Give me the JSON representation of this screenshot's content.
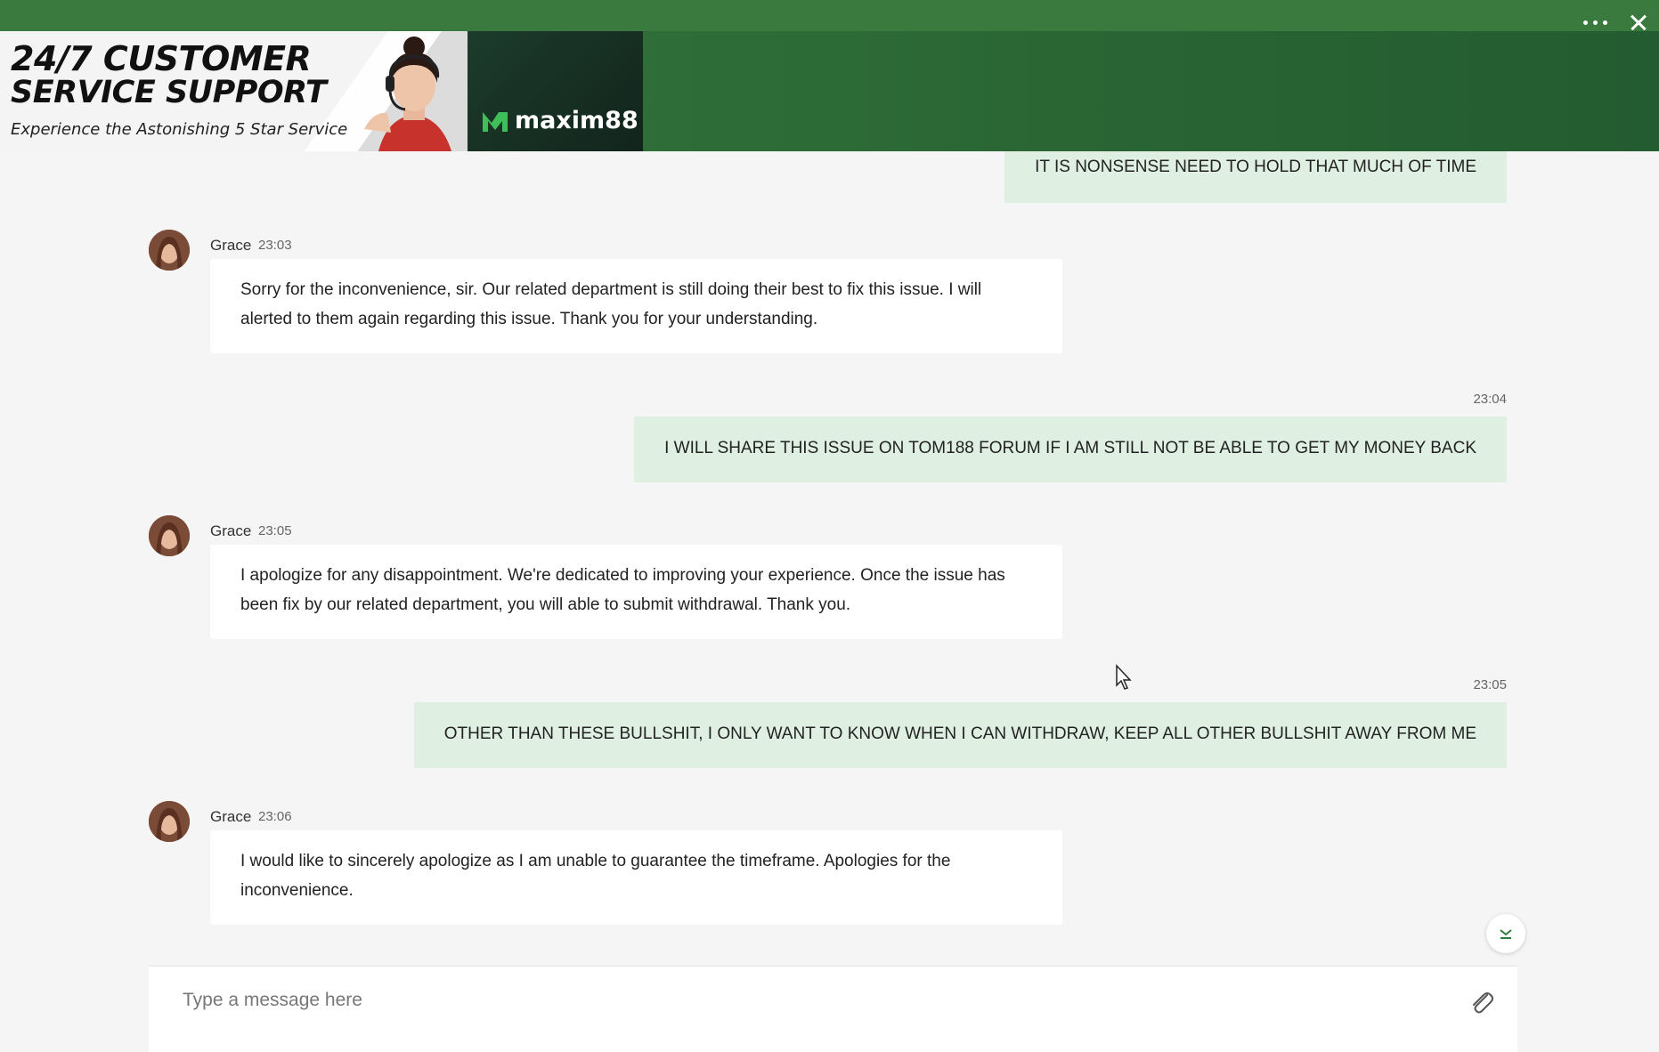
{
  "header": {
    "banner": {
      "title_line1": "24/7 CUSTOMER",
      "title_line2": "SERVICE SUPPORT",
      "subtitle": "Experience the Astonishing 5 Star Service",
      "brand": "maxim88"
    },
    "menu_icon": "more-horizontal-icon",
    "close_icon": "close-icon",
    "colors": {
      "header_bg": "#2e6b38",
      "outgoing_bubble": "#dff0e2",
      "incoming_bubble": "#ffffff"
    }
  },
  "messages": [
    {
      "from": "user",
      "time": "",
      "text": "IT IS NONSENSE NEED TO HOLD THAT MUCH OF TIME"
    },
    {
      "from": "agent",
      "name": "Grace",
      "time": "23:03",
      "text": "Sorry for the inconvenience, sir. Our related department is still doing their best to fix this issue. I will alerted to them again regarding this issue. Thank you for your understanding."
    },
    {
      "from": "user",
      "time": "23:04",
      "text": "I WILL SHARE THIS ISSUE ON TOM188 FORUM IF I AM STILL NOT BE ABLE TO GET MY MONEY BACK"
    },
    {
      "from": "agent",
      "name": "Grace",
      "time": "23:05",
      "text": "I apologize for any disappointment. We're dedicated to improving your experience. Once the issue has been fix by our related department, you will able to submit withdrawal. Thank you."
    },
    {
      "from": "user",
      "time": "23:05",
      "text": "OTHER THAN THESE BULLSHIT, I ONLY WANT TO KNOW WHEN I CAN WITHDRAW, KEEP ALL OTHER BULLSHIT AWAY FROM ME"
    },
    {
      "from": "agent",
      "name": "Grace",
      "time": "23:06",
      "text": "I would like to sincerely apologize as I am unable to guarantee the timeframe. Apologies for the inconvenience."
    }
  ],
  "composer": {
    "placeholder": "Type a message here",
    "attach_icon": "paperclip-icon",
    "scroll_icon": "chevron-down-icon"
  }
}
